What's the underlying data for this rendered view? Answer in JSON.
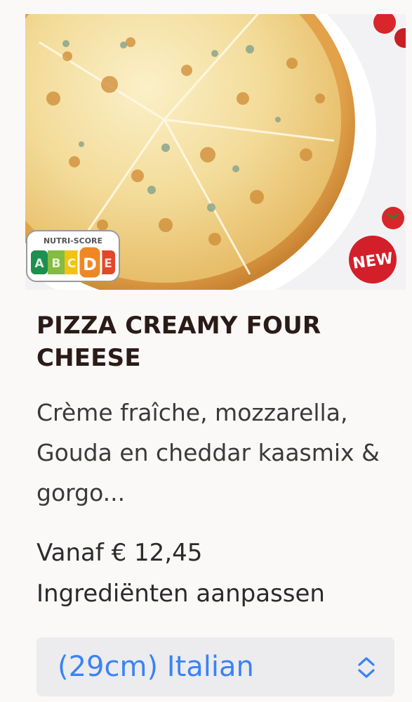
{
  "product": {
    "image_alt": "Pizza Creamy Four Cheese",
    "title": "PIZZA CREAMY FOUR CHEESE",
    "description": "Crème fraîche, mozzarella, Gouda en cheddar kaasmix & gorgo...",
    "price": "Vanaf € 12,45",
    "customize_label": "Ingrediënten aanpassen"
  },
  "nutri_score": {
    "label": "NUTRI-SCORE",
    "grades": [
      "A",
      "B",
      "C",
      "D",
      "E"
    ],
    "selected": "D",
    "colors": [
      "#1d8f4f",
      "#84bb40",
      "#f3c313",
      "#ef8724",
      "#e2462b"
    ]
  },
  "badge": {
    "text": "NEW",
    "color": "#d31f2a"
  },
  "size_select": {
    "value": "(29cm) Italian",
    "icon": "chevron-up-down-icon",
    "color": "#3b82f6"
  }
}
